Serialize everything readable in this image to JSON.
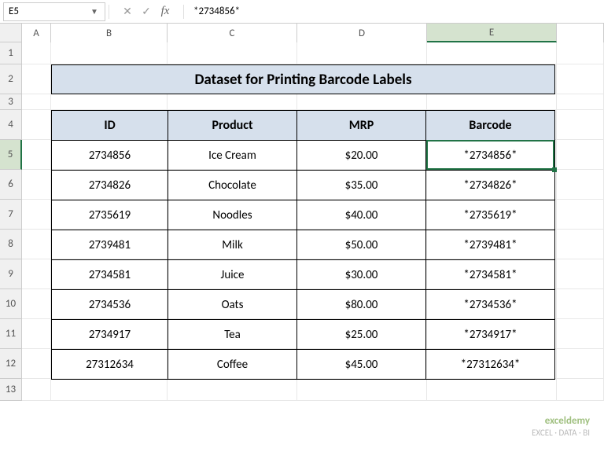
{
  "name_box": "E5",
  "formula_bar": {
    "value": "*2734856*",
    "fx_label": "fx"
  },
  "columns": [
    "A",
    "B",
    "C",
    "D",
    "E"
  ],
  "rows": [
    "1",
    "2",
    "3",
    "4",
    "5",
    "6",
    "7",
    "8",
    "9",
    "10",
    "11",
    "12",
    "13"
  ],
  "title": "Dataset for Printing Barcode Labels",
  "headers": {
    "id": "ID",
    "product": "Product",
    "mrp": "MRP",
    "barcode": "Barcode"
  },
  "data": [
    {
      "id": "2734856",
      "product": "Ice Cream",
      "mrp": "$20.00",
      "barcode": "*2734856*"
    },
    {
      "id": "2734826",
      "product": "Chocolate",
      "mrp": "$35.00",
      "barcode": "*2734826*"
    },
    {
      "id": "2735619",
      "product": "Noodles",
      "mrp": "$40.00",
      "barcode": "*2735619*"
    },
    {
      "id": "2739481",
      "product": "Milk",
      "mrp": "$50.00",
      "barcode": "*2739481*"
    },
    {
      "id": "2734581",
      "product": "Juice",
      "mrp": "$30.00",
      "barcode": "*2734581*"
    },
    {
      "id": "2734536",
      "product": "Oats",
      "mrp": "$80.00",
      "barcode": "*2734536*"
    },
    {
      "id": "2734917",
      "product": "Tea",
      "mrp": "$25.00",
      "barcode": "*2734917*"
    },
    {
      "id": "27312634",
      "product": "Coffee",
      "mrp": "$45.00",
      "barcode": "*27312634*"
    }
  ],
  "watermark": {
    "brand": "exceldemy",
    "tagline": "EXCEL · DATA · BI"
  },
  "selected_cell": "E5"
}
